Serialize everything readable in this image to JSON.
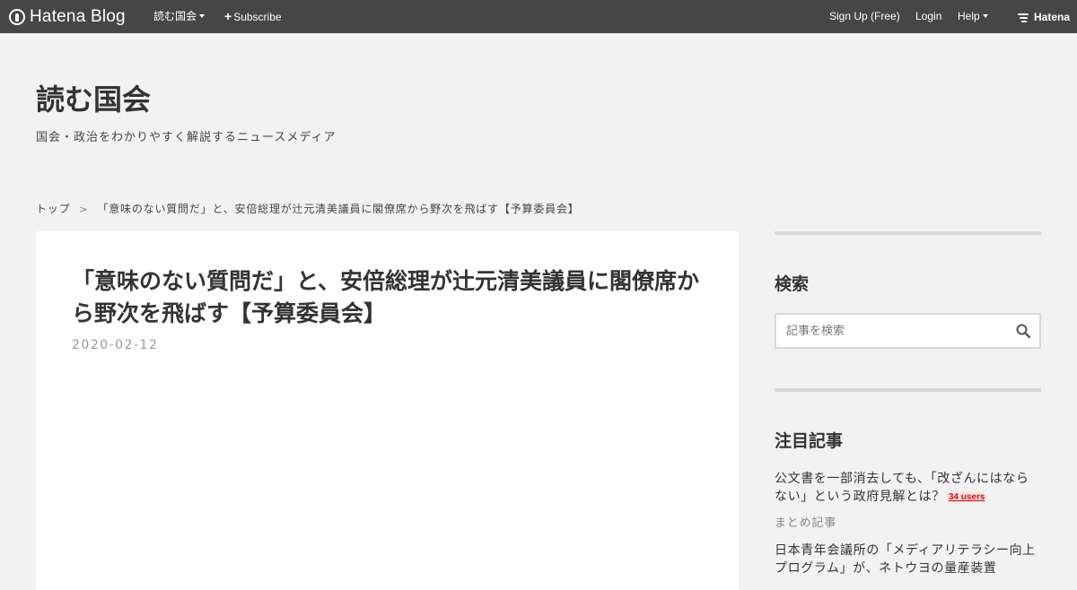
{
  "topbar": {
    "logo_text": "Hatena Blog",
    "blog_menu_label": "読む国会",
    "subscribe_label": "Subscribe",
    "signup_label": "Sign Up (Free)",
    "login_label": "Login",
    "help_label": "Help",
    "brand_label": "Hatena",
    "background_color": "#464646"
  },
  "blog": {
    "title": "読む国会",
    "description": "国会・政治をわかりやすく解説するニュースメディア"
  },
  "breadcrumb": {
    "home": "トップ",
    "separator": ">",
    "current": "「意味のない質問だ」と、安倍総理が辻元清美議員に閣僚席から野次を飛ばす【予算委員会】"
  },
  "article": {
    "title": "「意味のない質問だ」と、安倍総理が辻元清美議員に閣僚席から野次を飛ばす【予算委員会】",
    "date": "2020-02-12"
  },
  "sidebar": {
    "search": {
      "title": "検索",
      "placeholder": "記事を検索",
      "icon": "search-icon"
    },
    "hot_entries": {
      "title": "注目記事",
      "items": [
        {
          "title": "公文書を一部消去しても、「改ざんにはならない」という政府見解とは？",
          "users": "34 users",
          "category": "まとめ記事"
        },
        {
          "title": "日本青年会議所の「メディアリテラシー向上プログラム」が、ネトウヨの量産装置",
          "users": "",
          "category": ""
        }
      ]
    }
  },
  "colors": {
    "page_background": "#f2f2f2",
    "content_background": "#ffffff",
    "users_badge": "#dd0000"
  }
}
